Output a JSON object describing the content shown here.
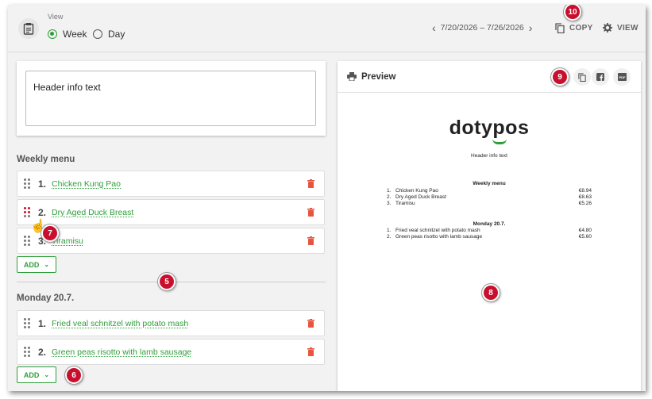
{
  "topbar": {
    "view_label": "View",
    "week_label": "Week",
    "day_label": "Day",
    "date_range": "7/20/2026 – 7/26/2026",
    "copy_label": "COPY",
    "view_btn_label": "VIEW"
  },
  "header_input": {
    "value": "Header info text"
  },
  "weekly": {
    "title": "Weekly menu",
    "items": [
      {
        "num": "1.",
        "name": "Chicken Kung Pao"
      },
      {
        "num": "2.",
        "name": "Dry Aged Duck Breast"
      },
      {
        "num": "3.",
        "name": "Tiramisu"
      }
    ],
    "add_label": "ADD"
  },
  "monday": {
    "title": "Monday 20.7.",
    "items": [
      {
        "num": "1.",
        "name": "Fried veal schnitzel with potato mash"
      },
      {
        "num": "2.",
        "name": "Green peas risotto with lamb sausage"
      }
    ],
    "add_label": "ADD"
  },
  "preview": {
    "title": "Preview",
    "brand": "dotypos",
    "header_text": "Header info text",
    "sections": [
      {
        "title": "Weekly menu",
        "rows": [
          {
            "num": "1.",
            "name": "Chicken Kung Pao",
            "price": "€8.94"
          },
          {
            "num": "2.",
            "name": "Dry Aged Duck Breast",
            "price": "€8.63"
          },
          {
            "num": "3.",
            "name": "Tiramisu",
            "price": "€5.26"
          }
        ]
      },
      {
        "title": "Monday 20.7.",
        "rows": [
          {
            "num": "1.",
            "name": "Fried veal schnitzel with potato mash",
            "price": "€4.80"
          },
          {
            "num": "2.",
            "name": "Green peas risotto with lamb sausage",
            "price": "€5.60"
          }
        ]
      }
    ]
  },
  "callouts": [
    "10",
    "9",
    "8",
    "7",
    "6",
    "5"
  ],
  "colors": {
    "accent": "#2e9e3a",
    "delete": "#e8553e",
    "callout": "#c8102e"
  }
}
